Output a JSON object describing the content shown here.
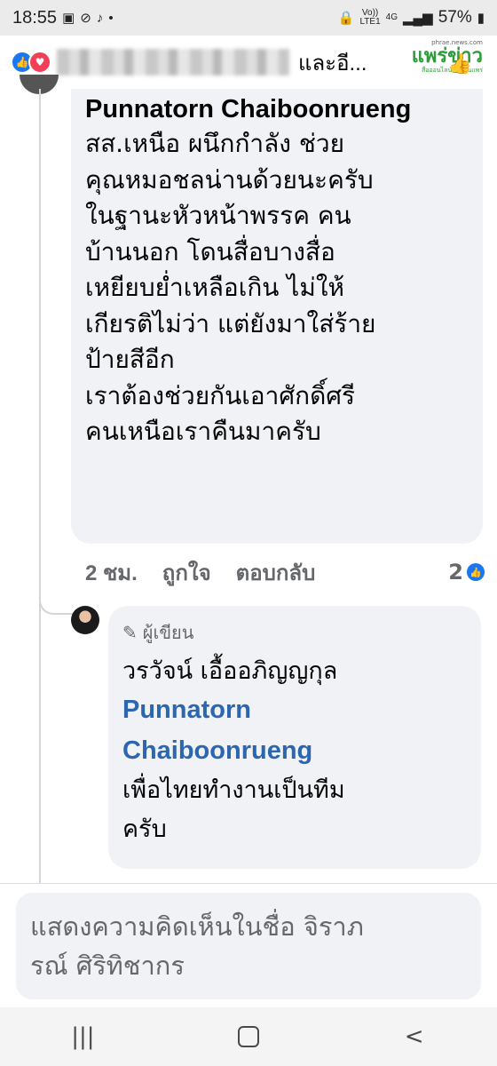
{
  "status_bar": {
    "time": "18:55",
    "network_top": "Vo))",
    "network_bottom": "LTE1",
    "signal_label": "4G",
    "battery": "57%"
  },
  "top_bar": {
    "text": "และอี..."
  },
  "watermark": {
    "url": "phrae.news.com",
    "logo": "แพร่ข่าว",
    "slogan": "สื่อออนไลน์ของคนแพร่"
  },
  "comment": {
    "author": "Punnatorn Chaiboonrueng",
    "lines": [
      "สส.เหนือ ผนึกกำลัง ช่วย",
      "คุณหมอชลน่านด้วยนะครับ",
      "ในฐานะหัวหน้าพรรค คน",
      "บ้านนอก โดนสื่อบางสื่อ",
      "เหยียบย่ำเหลือเกิน ไม่ให้",
      "เกียรติไม่ว่า แต่ยังมาใส่ร้าย",
      "ป้ายสีอีก",
      "เราต้องช่วยกันเอาศักดิ์ศรี",
      "คนเหนือเราคืนมาครับ"
    ],
    "time": "2 ชม.",
    "like_label": "ถูกใจ",
    "reply_label": "ตอบกลับ",
    "like_count": "2"
  },
  "reply": {
    "badge": "ผู้เขียน",
    "author": "วรวัจน์ เอื้ออภิญญกุล",
    "tag_lines": [
      "Punnatorn",
      "Chaiboonrueng"
    ],
    "lines": [
      "เพื่อไทยทำงานเป็นทีม",
      "ครับ"
    ]
  },
  "compose": {
    "placeholder_lines": [
      "แสดงความคิดเห็นในชื่อ จิราภ",
      "รณ์ ศิริทิชากร"
    ]
  },
  "nav": {
    "recents": "|||",
    "back": "<"
  },
  "icons": {
    "reaction_like": "thumbs-up-icon",
    "reaction_love": "heart-icon",
    "author_badge": "pencil-icon",
    "top_right": "thumbs-up-outline-icon"
  }
}
